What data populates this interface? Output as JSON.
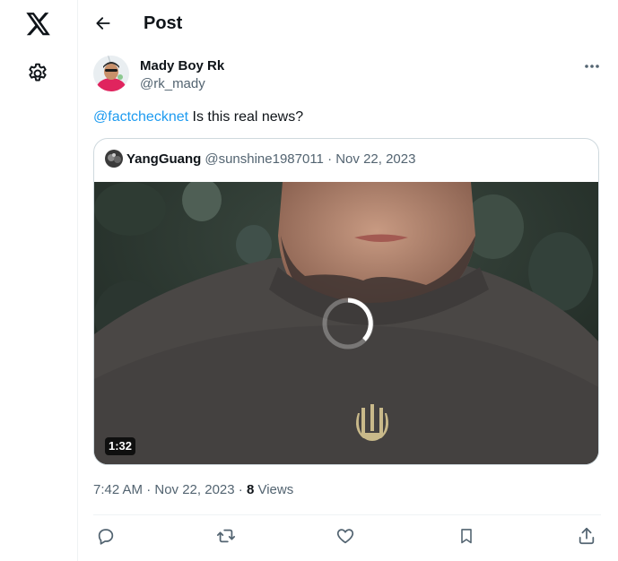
{
  "header": {
    "title": "Post"
  },
  "rail": {
    "logo_icon": "x-logo-icon",
    "settings_icon": "gear-icon"
  },
  "post": {
    "author_name": "Mady Boy Rk",
    "author_handle": "@rk_mady",
    "mention": "@factchecknet",
    "text": " Is this real news?",
    "timestamp": "7:42 AM · Nov 22, 2023",
    "views_separator": " · ",
    "views_count": "8",
    "views_label": " Views"
  },
  "quoted": {
    "name": "YangGuang",
    "handle_date": "@sunshine1987011 · Nov 22, 2023",
    "video_duration": "1:32"
  },
  "actions": {
    "icons": [
      "reply-icon",
      "retweet-icon",
      "like-icon",
      "bookmark-icon",
      "share-icon"
    ]
  },
  "colors": {
    "accent": "#1d9bf0",
    "secondary_text": "#536471",
    "border": "#cfd9de"
  }
}
